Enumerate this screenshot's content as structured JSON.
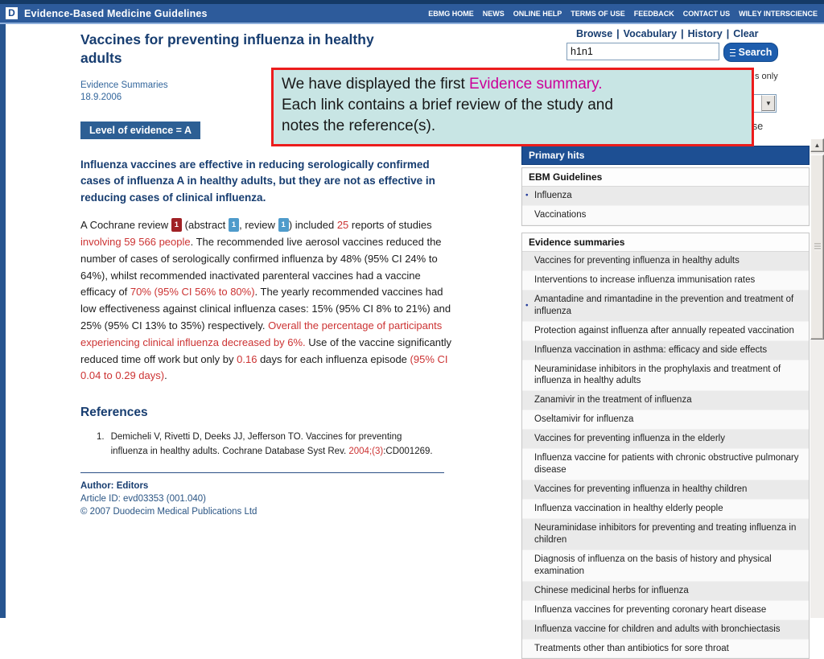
{
  "header": {
    "app_title": "Evidence-Based Medicine Guidelines",
    "logo_letter": "D",
    "nav": [
      "EBMG HOME",
      "NEWS",
      "ONLINE HELP",
      "TERMS OF USE",
      "FEEDBACK",
      "CONTACT US",
      "WILEY INTERSCIENCE"
    ]
  },
  "search": {
    "links": [
      "Browse",
      "Vocabulary",
      "History",
      "Clear"
    ],
    "query": "h1n1",
    "button_label": "Search",
    "titles_only_fragment": "s only",
    "database_fragment": "ase"
  },
  "callout": {
    "text_before": "We have displayed the first ",
    "highlight": "Evidence summary.",
    "text_after": "\nEach link contains a brief review of the study and\nnotes the reference(s)."
  },
  "article": {
    "title": "Vaccines for preventing influenza in healthy adults",
    "category": "Evidence Summaries",
    "date": "18.9.2006",
    "level_badge": "Level of evidence = A",
    "lead": "Influenza vaccines are effective in reducing serologically confirmed cases of influenza A in healthy adults, but they are not as effective in reducing cases of clinical influenza.",
    "body_segments": [
      {
        "t": "A Cochrane review ",
        "c": "text"
      },
      {
        "t": "1",
        "c": "refbox-red"
      },
      {
        "t": " (abstract ",
        "c": "text"
      },
      {
        "t": "1",
        "c": "refbox-blue"
      },
      {
        "t": ", review ",
        "c": "text"
      },
      {
        "t": "1",
        "c": "refbox-blue"
      },
      {
        "t": ") included ",
        "c": "text"
      },
      {
        "t": "25",
        "c": "red"
      },
      {
        "t": " reports of studies ",
        "c": "text"
      },
      {
        "t": "involving 59 566 people",
        "c": "red"
      },
      {
        "t": ". The recommended live aerosol vaccines reduced the number of cases of serologically confirmed influenza by 48% (95% CI 24% to 64%), whilst recommended inactivated parenteral vaccines had a vaccine efficacy of ",
        "c": "text"
      },
      {
        "t": "70% (95% CI 56% to 80%)",
        "c": "red"
      },
      {
        "t": ". The yearly recommended vaccines had low effectiveness against clinical influenza cases: 15% (95% CI 8% to 21%) and 25% (95% CI 13% to 35%) respectively. ",
        "c": "text"
      },
      {
        "t": "Overall the percentage of participants experiencing clinical influenza decreased by 6%.",
        "c": "red"
      },
      {
        "t": " Use of the vaccine significantly reduced time off work but only by ",
        "c": "text"
      },
      {
        "t": "0.16",
        "c": "red"
      },
      {
        "t": " days for each influenza episode ",
        "c": "text"
      },
      {
        "t": "(95% CI 0.04 to 0.29 days)",
        "c": "red"
      },
      {
        "t": ".",
        "c": "text"
      }
    ],
    "references_title": "References",
    "ref_number": "1.",
    "ref_segments": [
      {
        "t": "Demicheli V, Rivetti D, Deeks JJ, Jefferson TO. Vaccines for preventing influenza in healthy adults. Cochrane Database Syst Rev. ",
        "c": "text"
      },
      {
        "t": "2004;(3)",
        "c": "red"
      },
      {
        "t": ":CD001269.",
        "c": "text"
      }
    ],
    "author_line": "Author: Editors",
    "article_id_line": "Article ID: evd03353 (001.040)",
    "copyright_line": "© 2007 Duodecim Medical Publications Ltd"
  },
  "sidebar": {
    "primary_hits": "Primary hits",
    "sections": [
      {
        "title": "EBM Guidelines",
        "items": [
          {
            "label": "Influenza",
            "bullet": true
          },
          {
            "label": "Vaccinations",
            "bullet": false
          }
        ]
      },
      {
        "title": "Evidence summaries",
        "items": [
          {
            "label": "Vaccines for preventing influenza in healthy adults",
            "bullet": false
          },
          {
            "label": "Interventions to increase influenza immunisation rates",
            "bullet": false
          },
          {
            "label": "Amantadine and rimantadine in the prevention and treatment of influenza",
            "bullet": true
          },
          {
            "label": "Protection against influenza after annually repeated vaccination",
            "bullet": false
          },
          {
            "label": "Influenza vaccination in asthma: efficacy and side effects",
            "bullet": false
          },
          {
            "label": "Neuraminidase inhibitors in the prophylaxis and treatment of influenza in healthy adults",
            "bullet": false
          },
          {
            "label": "Zanamivir in the treatment of influenza",
            "bullet": false
          },
          {
            "label": "Oseltamivir for influenza",
            "bullet": false
          },
          {
            "label": "Vaccines for preventing influenza in the elderly",
            "bullet": false
          },
          {
            "label": "Influenza vaccine for patients with chronic obstructive pulmonary disease",
            "bullet": false
          },
          {
            "label": "Vaccines for preventing influenza in healthy children",
            "bullet": false
          },
          {
            "label": "Influenza vaccination in healthy elderly people",
            "bullet": false
          },
          {
            "label": "Neuraminidase inhibitors for preventing and treating influenza in children",
            "bullet": false
          },
          {
            "label": "Diagnosis of influenza on the basis of history and physical examination",
            "bullet": false
          },
          {
            "label": "Chinese medicinal herbs for influenza",
            "bullet": false
          },
          {
            "label": "Influenza vaccines for preventing coronary heart disease",
            "bullet": false
          },
          {
            "label": "Influenza vaccine for children and adults with bronchiectasis",
            "bullet": false
          },
          {
            "label": "Treatments other than antibiotics for sore throat",
            "bullet": false
          }
        ]
      }
    ]
  },
  "colors": {
    "topbar_blue": "#2d5b9b",
    "navy_text": "#173d70",
    "red_text": "#cc3333",
    "callout_bg": "#c8e5e4",
    "callout_border": "#ec1c1c",
    "highlight_magenta": "#cc0099",
    "badge_bg": "#2d5f94",
    "primary_hits_bg": "#1d4f93"
  }
}
